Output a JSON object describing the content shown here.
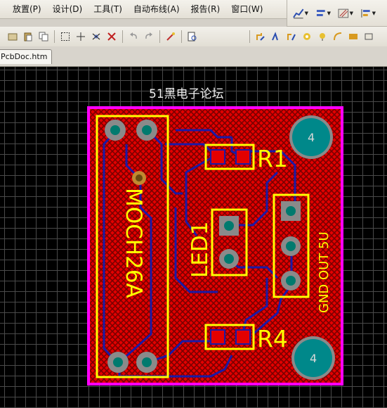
{
  "menu": {
    "items": [
      "放置(P)",
      "设计(D)",
      "工具(T)",
      "自动布线(A)",
      "报告(R)",
      "窗口(W)"
    ]
  },
  "toolbar_right": {
    "icons": [
      "chart-icon",
      "align-icon",
      "hatch-icon",
      "layers-icon"
    ]
  },
  "toolbar2": {
    "icons": [
      "open-icon",
      "paste-icon",
      "copy-icon",
      "select-rect-icon",
      "move-icon",
      "cut-move-icon",
      "cross-icon",
      "undo-icon",
      "redo-icon",
      "wand-icon",
      "zoom-fit-icon",
      "route-icon",
      "interactive-route-icon",
      "diff-route-icon",
      "via-icon",
      "pad-icon",
      "arc-icon",
      "fill-icon",
      "more-icon"
    ]
  },
  "tab": {
    "label": "PcbDoc.htm"
  },
  "board": {
    "title": "51黑电子论坛",
    "labels": {
      "r1": "R1",
      "r4": "R4",
      "led": "LED1",
      "moc": "MOCH26A",
      "out": "GND OUT 5U",
      "hole_tl": "4",
      "hole_br": "4"
    }
  },
  "colors": {
    "board_fill": "#e30000",
    "hatch": "#7a0000",
    "trace": "#1a1aa8",
    "silkscreen": "#ffff00",
    "outline": "#ff00ff",
    "pad": "#8a8a8a",
    "pad_center": "#007a6e",
    "mount_hole": "#00888a"
  }
}
